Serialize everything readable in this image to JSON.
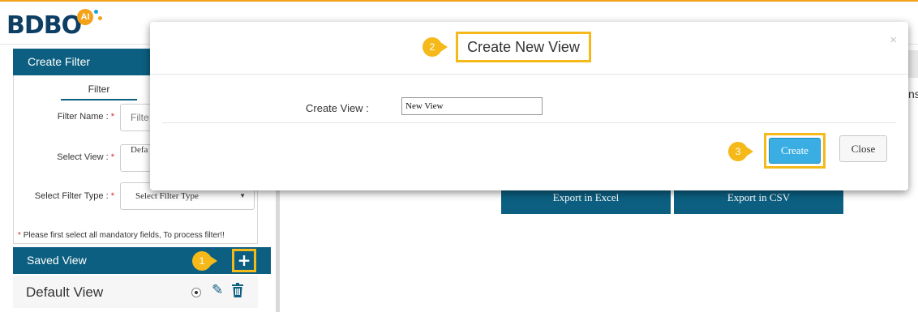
{
  "brand": {
    "logo_text": "BDBO",
    "logo_badge": "AI",
    "accent": "#f5a21b",
    "primary": "#0c5f80"
  },
  "create_filter": {
    "title": "Create Filter",
    "tab_label": "Filter",
    "filter_name_label": "Filter Name :",
    "filter_name_placeholder": "Filte",
    "select_view_label": "Select View :",
    "select_view_value": "Defa",
    "filter_type_label": "Select Filter Type :",
    "filter_type_value": "Select Filter Type",
    "required_mark": "*",
    "notice": "Please first select all mandatory fields, To process filter!!"
  },
  "saved_view": {
    "title": "Saved View",
    "add_icon": "plus-icon",
    "items": [
      {
        "label": "Default View"
      }
    ]
  },
  "background_buttons": {
    "export_excel": "Export in Excel",
    "export_csv": "Export in CSV",
    "partial_text": "ns"
  },
  "modal": {
    "title": "Create New View",
    "close_symbol": "×",
    "view_label": "Create View :",
    "view_value": "New View",
    "create_label": "Create",
    "close_label": "Close"
  },
  "steps": {
    "one": "1",
    "two": "2",
    "three": "3"
  }
}
